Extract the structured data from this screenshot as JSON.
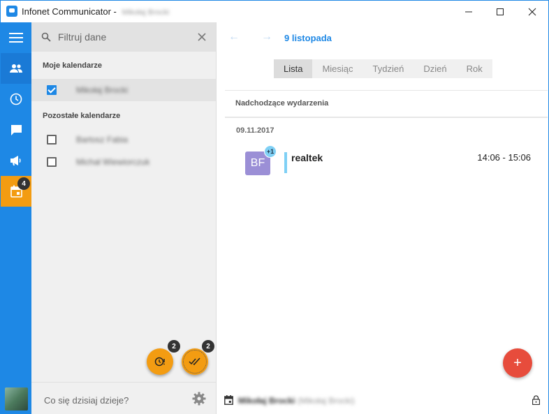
{
  "titlebar": {
    "title": "Infonet Communicator -",
    "user": "Mikołaj Brocki",
    "icons": [
      "app-icon",
      "minimize-icon",
      "maximize-icon",
      "close-icon"
    ]
  },
  "rail": {
    "menu_icon": "hamburger-icon",
    "items": [
      {
        "icon": "contacts-icon",
        "selected": true
      },
      {
        "icon": "clock-icon"
      },
      {
        "icon": "chat-icon"
      },
      {
        "icon": "megaphone-icon"
      },
      {
        "icon": "calendar-icon",
        "active": true,
        "badge": "4"
      }
    ]
  },
  "listpanel": {
    "search_placeholder": "Filtruj dane",
    "my_calendars_heading": "Moje kalendarze",
    "my_calendars": [
      {
        "name": "Mikołaj Brocki",
        "checked": true
      }
    ],
    "other_calendars_heading": "Pozostałe kalendarze",
    "other_calendars": [
      {
        "name": "Bartosz Fabia",
        "checked": false
      },
      {
        "name": "Michał Wiewiorczuk",
        "checked": false
      }
    ],
    "fab_reminders_badge": "2",
    "fab_done_badge": "2",
    "status_placeholder": "Co się dzisiaj dzieje?"
  },
  "main": {
    "date_title": "9 listopada",
    "tabs": [
      "Lista",
      "Miesiąc",
      "Tydzień",
      "Dzień",
      "Rok"
    ],
    "active_tab": "Lista",
    "upcoming_heading": "Nadchodzące wydarzenia",
    "groups": [
      {
        "date": "09.11.2017",
        "events": [
          {
            "initials": "BF",
            "extra": "+1",
            "title": "realtek",
            "time": "14:06 - 15:06"
          }
        ]
      }
    ],
    "add_label": "+",
    "footer_name": "Mikołaj Brocki",
    "footer_sub": "(Mikołaj Brocki)"
  },
  "colors": {
    "accent": "#1e88e5",
    "orange": "#f39c12",
    "red": "#e74c3c",
    "event_avatar": "#9b8fd6",
    "event_bar": "#7fd0f5"
  }
}
